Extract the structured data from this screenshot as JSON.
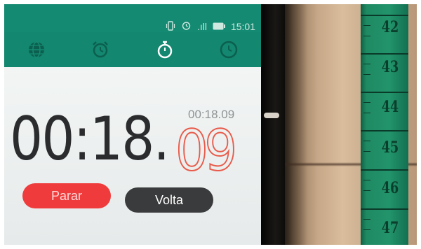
{
  "status_bar": {
    "time": "15:01",
    "signal_text": ".ıll"
  },
  "tabs": [
    {
      "icon": "globe-icon",
      "active": false
    },
    {
      "icon": "alarm-clock-icon",
      "active": false
    },
    {
      "icon": "stopwatch-icon",
      "active": true
    },
    {
      "icon": "timer-icon",
      "active": false
    }
  ],
  "stopwatch": {
    "lap_time": "00:18.09",
    "main_time": "00:18.",
    "centiseconds": "09"
  },
  "buttons": {
    "stop_label": "Parar",
    "lap_label": "Volta"
  },
  "ruler": {
    "numbers": [
      "42",
      "43",
      "44",
      "45",
      "46",
      "47"
    ]
  },
  "colors": {
    "accent": "#148a72",
    "stop": "#ef3b3b",
    "lap": "#3a3b3c",
    "centi": "#e85a4a",
    "ruler": "#22946b"
  }
}
